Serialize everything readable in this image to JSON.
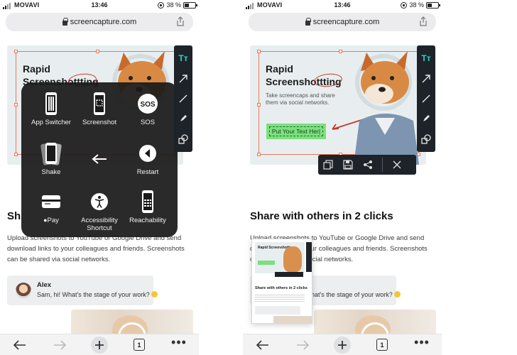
{
  "status": {
    "carrier": "MOVAVI",
    "time": "13:46",
    "battery": "38 %"
  },
  "browser": {
    "url": "screencapture.com",
    "tab_count": "1"
  },
  "hero": {
    "title_line1": "Rapid",
    "title_line2": "Screenshottting",
    "subtitle": "Take screencaps and share them via social networks.",
    "textbox": "Put Your Text Her|"
  },
  "editor": {
    "text_tool_label": "Tт"
  },
  "page": {
    "heading_left": "Sh",
    "heading_right": "Share with others in 2 clicks",
    "paragraph_left": "Upload screenshots to YouTube or Google Drive and send download links to your colleagues and friends. Screenshots can be shared via social networks.",
    "paragraph_right": "Upload screenshots to YouTube or Google Drive and send download links to your colleagues and friends. Screenshots can be shared via social networks."
  },
  "chat": {
    "name": "Alex",
    "message": "Sam, hi! What's the stage of your work?"
  },
  "assistive_touch": {
    "items": [
      {
        "label": "App Switcher",
        "icon": "app-switcher-icon"
      },
      {
        "label": "Screenshot",
        "icon": "screenshot-icon"
      },
      {
        "label": "SOS",
        "icon": "sos-icon"
      },
      {
        "label": "Shake",
        "icon": "shake-icon"
      },
      {
        "label": "",
        "icon": "back-arrow-icon"
      },
      {
        "label": "Restart",
        "icon": "restart-icon"
      },
      {
        "label": "Pay",
        "icon": "apple-pay-icon"
      },
      {
        "label": "Accessibility\nShortcut",
        "icon": "accessibility-icon"
      },
      {
        "label": "Reachability",
        "icon": "reachability-icon"
      }
    ],
    "sos_badge": "SOS"
  },
  "thumbnail": {
    "title": "Rapid Screenshotting",
    "heading": "Share with others in 2 clicks"
  },
  "colors": {
    "accent_teal": "#27d3c7",
    "selection_orange": "#e8765b",
    "annotation_red": "#c8352b",
    "textbox_green": "#7be07e",
    "toolbar_dark": "#1e2329"
  }
}
